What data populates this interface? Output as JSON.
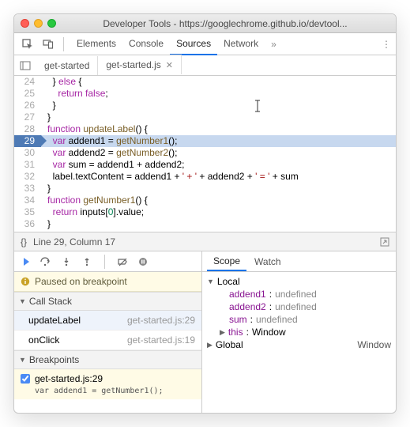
{
  "window": {
    "title": "Developer Tools - https://googlechrome.github.io/devtool..."
  },
  "toolbar": {
    "tabs": [
      "Elements",
      "Console",
      "Sources",
      "Network"
    ],
    "activeTab": "Sources",
    "more": "»"
  },
  "fileTabs": {
    "items": [
      {
        "label": "get-started",
        "active": false
      },
      {
        "label": "get-started.js",
        "active": true
      }
    ]
  },
  "code": {
    "lines": [
      {
        "n": 24,
        "html": "  } <span class='kw'>else</span> {"
      },
      {
        "n": 25,
        "html": "    <span class='kw'>return</span> <span class='kw'>false</span>;"
      },
      {
        "n": 26,
        "html": "  }"
      },
      {
        "n": 27,
        "html": "}"
      },
      {
        "n": 28,
        "html": "<span class='kw'>function</span> <span class='fn'>updateLabel</span>() {"
      },
      {
        "n": 29,
        "html": "  <span class='kw'>var</span> addend1 = <span class='fn'>getNumber1</span>();",
        "hl": true,
        "bp": true
      },
      {
        "n": 30,
        "html": "  <span class='kw'>var</span> addend2 = <span class='fn'>getNumber2</span>();"
      },
      {
        "n": 31,
        "html": "  <span class='kw'>var</span> sum = addend1 + addend2;"
      },
      {
        "n": 32,
        "html": "  label.textContent = addend1 + <span class='str'>' + '</span> + addend2 + <span class='str'>' = '</span> + sum"
      },
      {
        "n": 33,
        "html": "}"
      },
      {
        "n": 34,
        "html": "<span class='kw'>function</span> <span class='fn'>getNumber1</span>() {"
      },
      {
        "n": 35,
        "html": "  <span class='kw'>return</span> inputs[<span class='num'>0</span>].value;"
      },
      {
        "n": 36,
        "html": "}"
      }
    ]
  },
  "status": {
    "location": "Line 29, Column 17",
    "braces": "{}"
  },
  "debugger": {
    "paused": "Paused on breakpoint",
    "callStack": {
      "header": "Call Stack",
      "items": [
        {
          "fn": "updateLabel",
          "loc": "get-started.js:29",
          "selected": true
        },
        {
          "fn": "onClick",
          "loc": "get-started.js:19",
          "selected": false
        }
      ]
    },
    "breakpoints": {
      "header": "Breakpoints",
      "items": [
        {
          "label": "get-started.js:29",
          "code": "var addend1 = getNumber1();",
          "checked": true
        }
      ]
    },
    "scopeTabs": [
      "Scope",
      "Watch"
    ],
    "activeScopeTab": "Scope",
    "scope": {
      "local": {
        "label": "Local",
        "vars": [
          {
            "name": "addend1",
            "val": "undefined"
          },
          {
            "name": "addend2",
            "val": "undefined"
          },
          {
            "name": "sum",
            "val": "undefined"
          },
          {
            "name": "this",
            "val": "Window",
            "expandable": true
          }
        ]
      },
      "global": {
        "label": "Global",
        "right": "Window"
      }
    }
  }
}
